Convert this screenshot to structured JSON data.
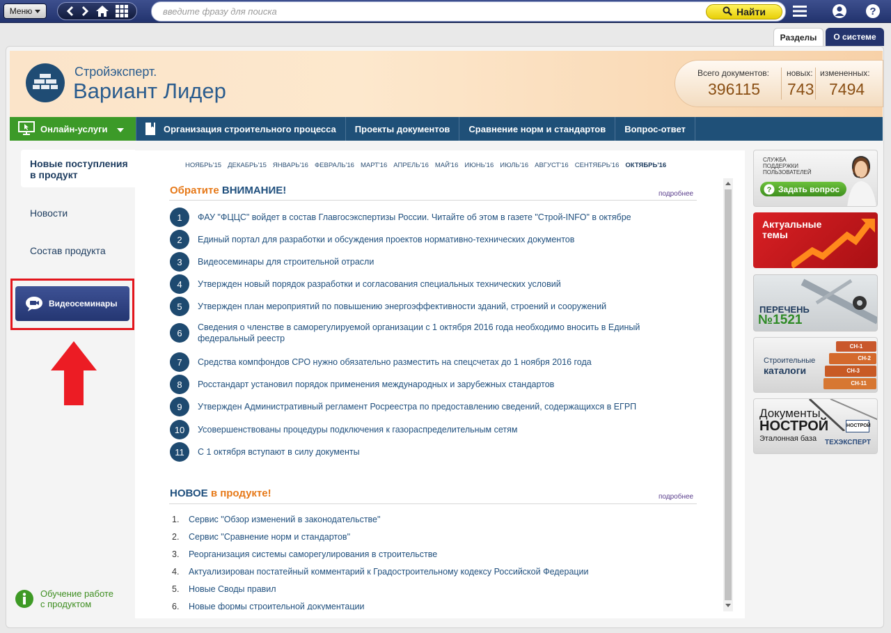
{
  "toolbar": {
    "menu_label": "Меню",
    "search_placeholder": "введите фразу для поиска",
    "find_label": "Найти"
  },
  "tabs": [
    "Разделы",
    "О системе"
  ],
  "header": {
    "brand_small": "Стройэксперт.",
    "brand_large": "Вариант Лидер",
    "stats": [
      {
        "label": "Всего документов:",
        "value": "396115"
      },
      {
        "label": "новых:",
        "value": "743"
      },
      {
        "label": "измененных:",
        "value": "7494"
      }
    ]
  },
  "navbar": {
    "online": "Онлайн-услуги",
    "items": [
      "Организация строительного процесса",
      "Проекты документов",
      "Сравнение норм и стандартов",
      "Вопрос-ответ"
    ]
  },
  "left_menu": {
    "active": "Новые поступления в продукт",
    "items": [
      "Новости",
      "Состав продукта"
    ],
    "video_button": "Видеосеминары",
    "learn": "Обучение работе с продуктом"
  },
  "months": [
    "НОЯБРЬ'15",
    "ДЕКАБРЬ'15",
    "ЯНВАРЬ'16",
    "ФЕВРАЛЬ'16",
    "МАРТ'16",
    "АПРЕЛЬ'16",
    "МАЙ'16",
    "ИЮНЬ'16",
    "ИЮЛЬ'16",
    "АВГУСТ'16",
    "СЕНТЯБРЬ'16",
    "ОКТЯБРЬ'16"
  ],
  "attention": {
    "title_part1": "Обратите",
    "title_part2": "ВНИМАНИЕ!",
    "more": "подробнее",
    "items": [
      "ФАУ \"ФЦЦС\" войдет в состав Главгосэкспертизы России. Читайте об этом в газете \"Строй-INFO\" в октябре",
      "Единый портал для разработки и обсуждения проектов нормативно-технических документов",
      "Видеосеминары для строительной отрасли",
      "Утвержден новый порядок разработки и согласования специальных технических условий",
      "Утвержден план мероприятий по повышению энергоэффективности зданий, строений и сооружений",
      "Сведения о членстве в саморегулируемой организации с 1 октября 2016 года необходимо вносить в Единый федеральный реестр",
      "Средства компфондов СРО нужно обязательно разместить на спецсчетах до 1 ноября 2016 года",
      "Росстандарт установил порядок применения международных и зарубежных стандартов",
      "Утвержден Административный регламент Росреестра по предоставлению сведений, содержащихся в ЕГРП",
      "Усовершенствованы процедуры подключения к газораспределительным сетям",
      "С 1 октября вступают в силу документы"
    ]
  },
  "new_in_product": {
    "title_part1": "НОВОЕ",
    "title_part2": "в продукте!",
    "more": "подробнее",
    "items": [
      "Сервис \"Обзор изменений в законодательстве\"",
      "Сервис \"Сравнение норм и стандартов\"",
      "Реорганизация системы саморегулирования в строительстве",
      "Актуализирован постатейный комментарий к Градостроительному кодексу Российской Федерации",
      "Новые Своды правил",
      "Новые формы строительной документации"
    ]
  },
  "banners": {
    "support_line1": "СЛУЖБА",
    "support_line2": "ПОДДЕРЖКИ",
    "support_line3": "ПОЛЬЗОВАТЕЛЕЙ",
    "ask": "Задать вопрос",
    "topics_line1": "Актуальные",
    "topics_line2": "темы",
    "list_line1": "ПЕРЕЧЕНЬ",
    "list_line2": "№1521",
    "catalog_line1": "Строительные",
    "catalog_line2": "каталоги",
    "sn_labels": [
      "СН-1",
      "СН-2",
      "СН-3",
      "СН-11"
    ],
    "nostroy_line1": "Документы",
    "nostroy_line2": "НОСТРОЙ",
    "nostroy_line3": "Эталонная база",
    "nostroy_badge": "НОСТРОЙ",
    "texexpert": "ТЕХЭКСПЕРТ"
  }
}
